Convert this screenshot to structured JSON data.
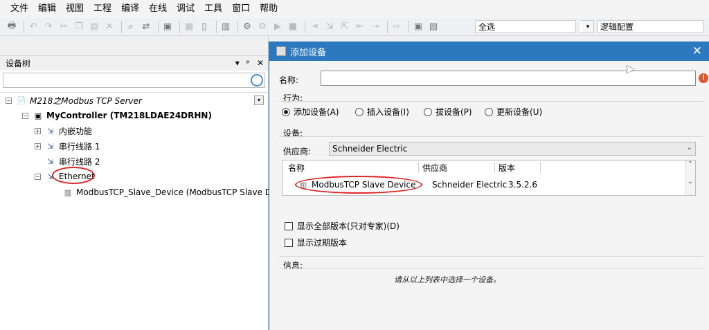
{
  "menu": [
    "文件",
    "编辑",
    "视图",
    "工程",
    "编译",
    "在线",
    "调试",
    "工具",
    "窗口",
    "帮助"
  ],
  "toolbar": {
    "select_all_combo": "全选",
    "config_combo": "逻辑配置"
  },
  "device_tree": {
    "title": "设备树",
    "search_placeholder": "",
    "root": "M218之Modbus TCP Server",
    "controller": "MyController (TM218LDAE24DRHN)",
    "items": [
      "内嵌功能",
      "串行线路 1",
      "串行线路 2",
      "Ethernet"
    ],
    "child": "ModbusTCP_Slave_Device (ModbusTCP Slave Device)"
  },
  "dialog": {
    "title": "添加设备",
    "name_label": "名称:",
    "name_value": "",
    "action_group": "行为:",
    "actions": [
      {
        "label": "添加设备(A)",
        "selected": true
      },
      {
        "label": "插入设备(I)",
        "selected": false
      },
      {
        "label": "拔设备(P)",
        "selected": false
      },
      {
        "label": "更新设备(U)",
        "selected": false
      }
    ],
    "device_group": "设备:",
    "vendor_label": "供应商:",
    "vendor_value": "Schneider Electric",
    "columns": [
      "名称",
      "供应商",
      "版本"
    ],
    "rows": [
      {
        "name": "ModbusTCP Slave Device",
        "vendor": "Schneider Electric",
        "version": "3.5.2.6"
      }
    ],
    "show_all_versions": "显示全部版本(只对专家)(D)",
    "show_outdated": "显示过期版本",
    "info_group": "信息:",
    "info_text": "请从以上列表中选择一个设备。"
  },
  "colors": {
    "titlebar": "#2d79c0",
    "highlight_ellipse": "#e02424"
  }
}
